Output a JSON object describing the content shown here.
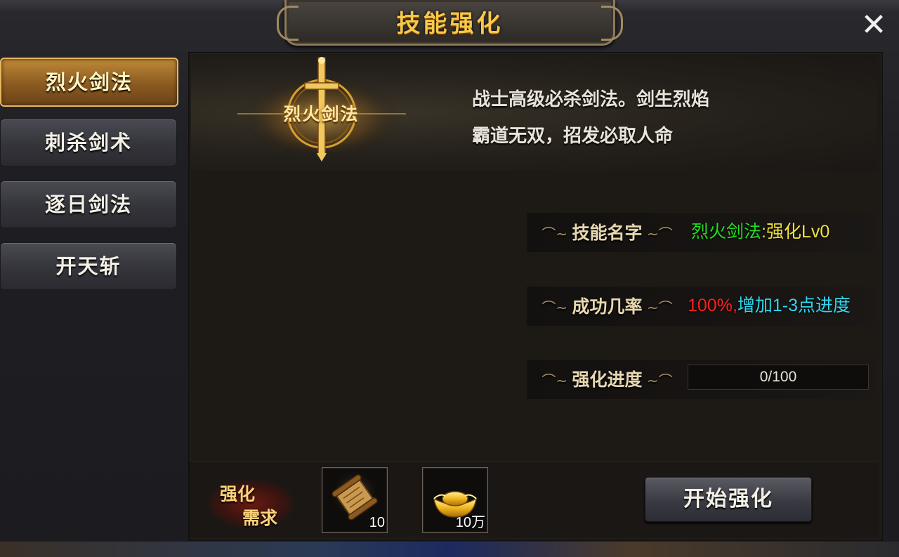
{
  "title": "技能强化",
  "close_icon": "close-icon",
  "skills": [
    {
      "label": "烈火剑法",
      "active": true
    },
    {
      "label": "刺杀剑术",
      "active": false
    },
    {
      "label": "逐日剑法",
      "active": false
    },
    {
      "label": "开天斩",
      "active": false
    }
  ],
  "selected_skill": {
    "emblem_name": "烈火剑法",
    "emblem_icon": "sword-icon",
    "description_lines": [
      "战士高级必杀剑法。剑生烈焰",
      "霸道无双，招发必取人命"
    ]
  },
  "info": {
    "name_label": "技能名字",
    "name_value_skill": "烈火剑法",
    "name_value_level": ":强化Lv0",
    "rate_label": "成功几率",
    "rate_value": "100%,",
    "rate_extra": "增加1-3点进度",
    "progress_label": "强化进度",
    "progress_value": "0/100",
    "progress_fraction": 0
  },
  "requirements": {
    "label_top": "强化",
    "label_bottom": "需求",
    "items": [
      {
        "icon": "scroll-icon",
        "count": "10"
      },
      {
        "icon": "gold-ingot-icon",
        "count": "10万"
      }
    ]
  },
  "start_button": "开始强化",
  "colors": {
    "title_gold": "#f7c94a",
    "skill_green": "#22dd22",
    "level_yellow": "#f0e040",
    "rate_red": "#ff2020",
    "rate_cyan": "#30d8f0"
  }
}
